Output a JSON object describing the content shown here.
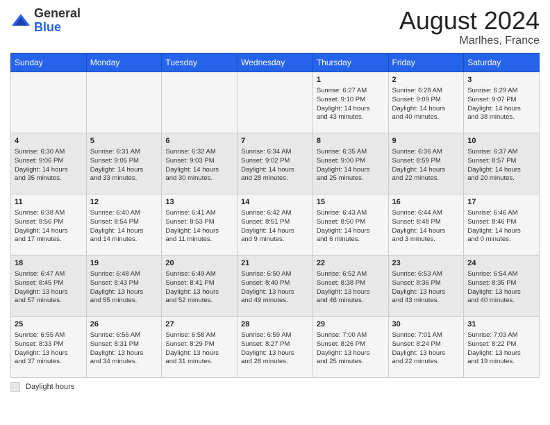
{
  "header": {
    "logo": {
      "general": "General",
      "blue": "Blue"
    },
    "title": "August 2024",
    "location": "Marlhes, France"
  },
  "weekdays": [
    "Sunday",
    "Monday",
    "Tuesday",
    "Wednesday",
    "Thursday",
    "Friday",
    "Saturday"
  ],
  "weeks": [
    [
      {
        "day": "",
        "info": ""
      },
      {
        "day": "",
        "info": ""
      },
      {
        "day": "",
        "info": ""
      },
      {
        "day": "",
        "info": ""
      },
      {
        "day": "1",
        "info": "Sunrise: 6:27 AM\nSunset: 9:10 PM\nDaylight: 14 hours\nand 43 minutes."
      },
      {
        "day": "2",
        "info": "Sunrise: 6:28 AM\nSunset: 9:09 PM\nDaylight: 14 hours\nand 40 minutes."
      },
      {
        "day": "3",
        "info": "Sunrise: 6:29 AM\nSunset: 9:07 PM\nDaylight: 14 hours\nand 38 minutes."
      }
    ],
    [
      {
        "day": "4",
        "info": "Sunrise: 6:30 AM\nSunset: 9:06 PM\nDaylight: 14 hours\nand 35 minutes."
      },
      {
        "day": "5",
        "info": "Sunrise: 6:31 AM\nSunset: 9:05 PM\nDaylight: 14 hours\nand 33 minutes."
      },
      {
        "day": "6",
        "info": "Sunrise: 6:32 AM\nSunset: 9:03 PM\nDaylight: 14 hours\nand 30 minutes."
      },
      {
        "day": "7",
        "info": "Sunrise: 6:34 AM\nSunset: 9:02 PM\nDaylight: 14 hours\nand 28 minutes."
      },
      {
        "day": "8",
        "info": "Sunrise: 6:35 AM\nSunset: 9:00 PM\nDaylight: 14 hours\nand 25 minutes."
      },
      {
        "day": "9",
        "info": "Sunrise: 6:36 AM\nSunset: 8:59 PM\nDaylight: 14 hours\nand 22 minutes."
      },
      {
        "day": "10",
        "info": "Sunrise: 6:37 AM\nSunset: 8:57 PM\nDaylight: 14 hours\nand 20 minutes."
      }
    ],
    [
      {
        "day": "11",
        "info": "Sunrise: 6:38 AM\nSunset: 8:56 PM\nDaylight: 14 hours\nand 17 minutes."
      },
      {
        "day": "12",
        "info": "Sunrise: 6:40 AM\nSunset: 8:54 PM\nDaylight: 14 hours\nand 14 minutes."
      },
      {
        "day": "13",
        "info": "Sunrise: 6:41 AM\nSunset: 8:53 PM\nDaylight: 14 hours\nand 11 minutes."
      },
      {
        "day": "14",
        "info": "Sunrise: 6:42 AM\nSunset: 8:51 PM\nDaylight: 14 hours\nand 9 minutes."
      },
      {
        "day": "15",
        "info": "Sunrise: 6:43 AM\nSunset: 8:50 PM\nDaylight: 14 hours\nand 6 minutes."
      },
      {
        "day": "16",
        "info": "Sunrise: 6:44 AM\nSunset: 8:48 PM\nDaylight: 14 hours\nand 3 minutes."
      },
      {
        "day": "17",
        "info": "Sunrise: 6:46 AM\nSunset: 8:46 PM\nDaylight: 14 hours\nand 0 minutes."
      }
    ],
    [
      {
        "day": "18",
        "info": "Sunrise: 6:47 AM\nSunset: 8:45 PM\nDaylight: 13 hours\nand 57 minutes."
      },
      {
        "day": "19",
        "info": "Sunrise: 6:48 AM\nSunset: 8:43 PM\nDaylight: 13 hours\nand 55 minutes."
      },
      {
        "day": "20",
        "info": "Sunrise: 6:49 AM\nSunset: 8:41 PM\nDaylight: 13 hours\nand 52 minutes."
      },
      {
        "day": "21",
        "info": "Sunrise: 6:50 AM\nSunset: 8:40 PM\nDaylight: 13 hours\nand 49 minutes."
      },
      {
        "day": "22",
        "info": "Sunrise: 6:52 AM\nSunset: 8:38 PM\nDaylight: 13 hours\nand 46 minutes."
      },
      {
        "day": "23",
        "info": "Sunrise: 6:53 AM\nSunset: 8:36 PM\nDaylight: 13 hours\nand 43 minutes."
      },
      {
        "day": "24",
        "info": "Sunrise: 6:54 AM\nSunset: 8:35 PM\nDaylight: 13 hours\nand 40 minutes."
      }
    ],
    [
      {
        "day": "25",
        "info": "Sunrise: 6:55 AM\nSunset: 8:33 PM\nDaylight: 13 hours\nand 37 minutes."
      },
      {
        "day": "26",
        "info": "Sunrise: 6:56 AM\nSunset: 8:31 PM\nDaylight: 13 hours\nand 34 minutes."
      },
      {
        "day": "27",
        "info": "Sunrise: 6:58 AM\nSunset: 8:29 PM\nDaylight: 13 hours\nand 31 minutes."
      },
      {
        "day": "28",
        "info": "Sunrise: 6:59 AM\nSunset: 8:27 PM\nDaylight: 13 hours\nand 28 minutes."
      },
      {
        "day": "29",
        "info": "Sunrise: 7:00 AM\nSunset: 8:26 PM\nDaylight: 13 hours\nand 25 minutes."
      },
      {
        "day": "30",
        "info": "Sunrise: 7:01 AM\nSunset: 8:24 PM\nDaylight: 13 hours\nand 22 minutes."
      },
      {
        "day": "31",
        "info": "Sunrise: 7:03 AM\nSunset: 8:22 PM\nDaylight: 13 hours\nand 19 minutes."
      }
    ]
  ],
  "footer": {
    "legend_label": "Daylight hours"
  }
}
